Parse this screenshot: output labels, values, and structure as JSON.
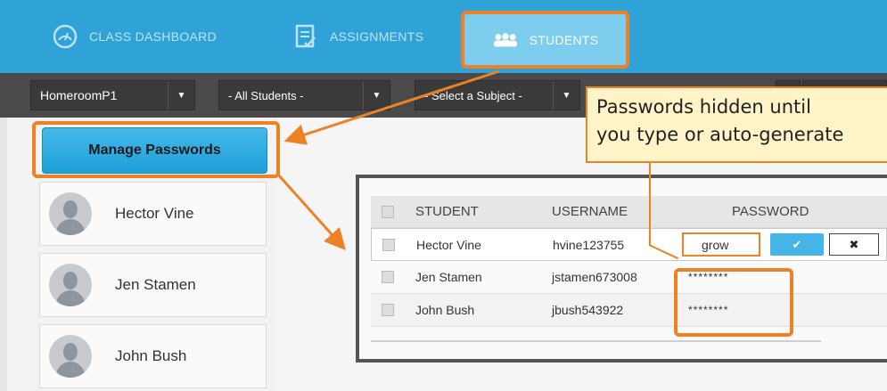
{
  "nav": {
    "items": [
      {
        "label": "CLASS DASHBOARD",
        "icon": "dashboard-gauge-icon"
      },
      {
        "label": "ASSIGNMENTS",
        "icon": "assignment-doc-icon"
      },
      {
        "label": "STUDENTS",
        "icon": "students-group-icon",
        "active": true
      }
    ]
  },
  "filters": {
    "class": "HomeroomP1",
    "students": "- All Students -",
    "subject": "- Select a Subject -"
  },
  "sidebar": {
    "manage_label": "Manage Passwords",
    "students": [
      "Hector Vine",
      "Jen Stamen",
      "John Bush"
    ]
  },
  "callout": {
    "line1": "Passwords hidden until",
    "line2": "you type or auto-generate"
  },
  "table": {
    "headers": {
      "student": "STUDENT",
      "username": "USERNAME",
      "password": "PASSWORD"
    },
    "rows": [
      {
        "student": "Hector Vine",
        "username": "hvine123755",
        "password": "grow"
      },
      {
        "student": "Jen Stamen",
        "username": "jstamen673008",
        "password": "********"
      },
      {
        "student": "John Bush",
        "username": "jbush543922",
        "password": "********"
      }
    ],
    "ok_label": "✔",
    "cancel_label": "✖"
  },
  "colors": {
    "accent": "#ec8126",
    "nav": "#2fa2d8",
    "button": "#1e9fd8"
  }
}
